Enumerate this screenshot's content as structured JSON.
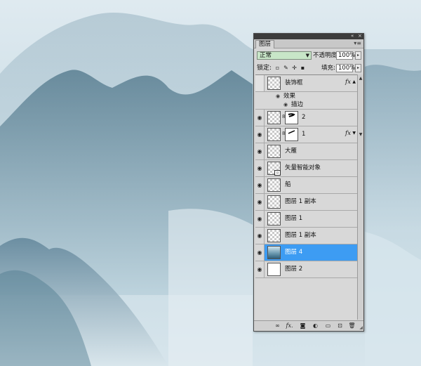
{
  "panel": {
    "tab_label": "图层",
    "blend_mode": "正常",
    "opacity_label": "不透明度:",
    "opacity_value": "100%",
    "lock_label": "锁定:",
    "fill_label": "填充:",
    "fill_value": "100%"
  },
  "layers": [
    {
      "name": "装饰框",
      "visible": false,
      "thumb": "transparent",
      "has_fx": true
    },
    {
      "name": "2",
      "visible": true,
      "thumb": "transparent",
      "has_mask": true
    },
    {
      "name": "1",
      "visible": true,
      "thumb": "transparent",
      "has_mask": true,
      "has_fx": true
    },
    {
      "name": "大雁",
      "visible": true,
      "thumb": "transparent"
    },
    {
      "name": "矢量智能对象",
      "visible": true,
      "thumb": "transparent",
      "smart_object": true
    },
    {
      "name": "船",
      "visible": true,
      "thumb": "transparent"
    },
    {
      "name": "图层 1 副本",
      "visible": true,
      "thumb": "transparent"
    },
    {
      "name": "图层 1",
      "visible": true,
      "thumb": "transparent"
    },
    {
      "name": "图层 1 副本",
      "visible": true,
      "thumb": "transparent"
    },
    {
      "name": "图层 4",
      "visible": true,
      "thumb": "photo",
      "selected": true
    },
    {
      "name": "图层 2",
      "visible": true,
      "thumb": "white"
    }
  ],
  "effects": {
    "effects_label": "效果",
    "stroke_label": "描边"
  },
  "icons": {
    "eye": "eye-icon",
    "link": "link-icon",
    "fx": "fx-icon",
    "new_layer": "new-layer-icon",
    "trash": "trash-icon"
  },
  "colors": {
    "selected_row": "#3d9cf3",
    "blend_field": "#c8e6c8",
    "panel_bg": "#d6d6d6"
  }
}
